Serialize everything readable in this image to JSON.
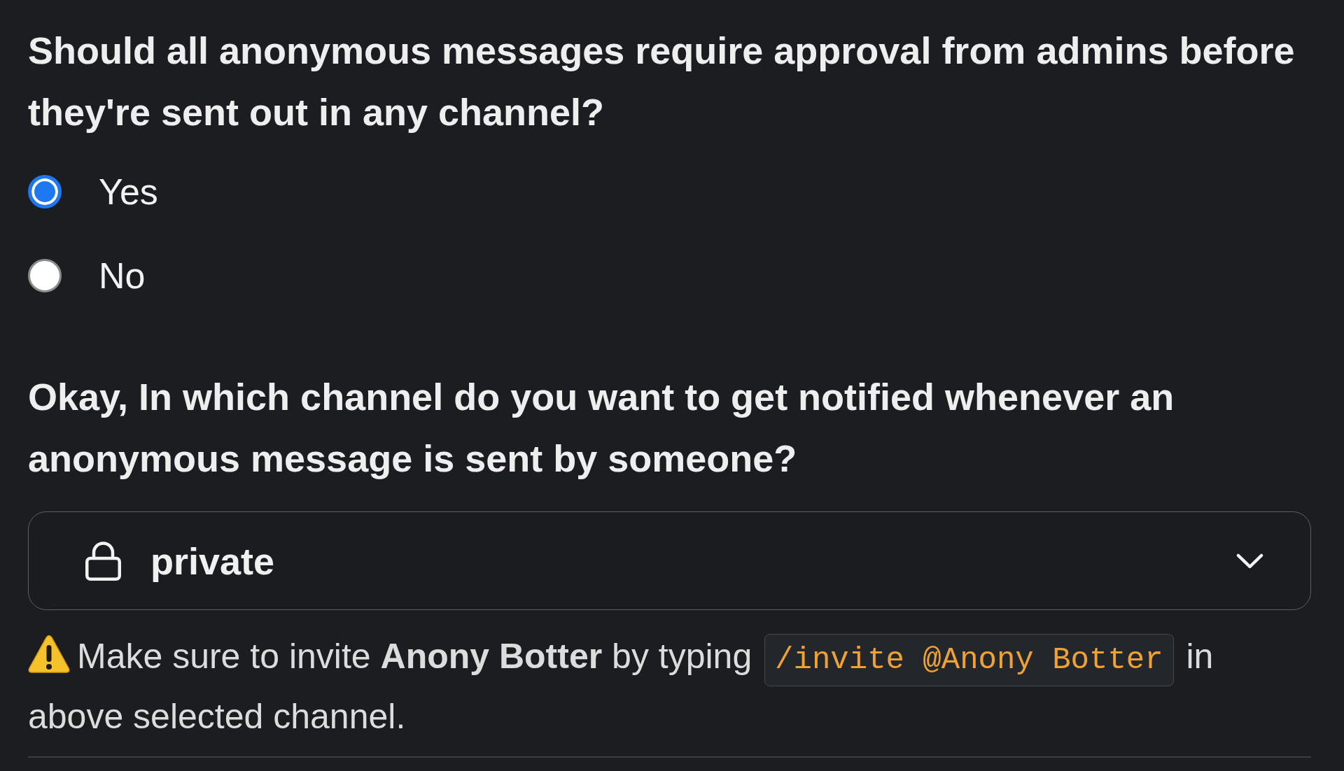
{
  "question_1": {
    "text": "Should all anonymous messages require approval from admins before they're sent out in any channel?",
    "options": [
      {
        "label": "Yes",
        "selected": true
      },
      {
        "label": "No",
        "selected": false
      }
    ]
  },
  "question_2": {
    "text": "Okay, In which channel do you want to get notified whenever an anonymous message is sent by someone?",
    "channel_select": {
      "value": "private"
    }
  },
  "notice": {
    "text_before": "Make sure to invite **Anony Botter** by typing",
    "command": "/invite @Anony Botter",
    "text_after": "in above selected channel."
  }
}
